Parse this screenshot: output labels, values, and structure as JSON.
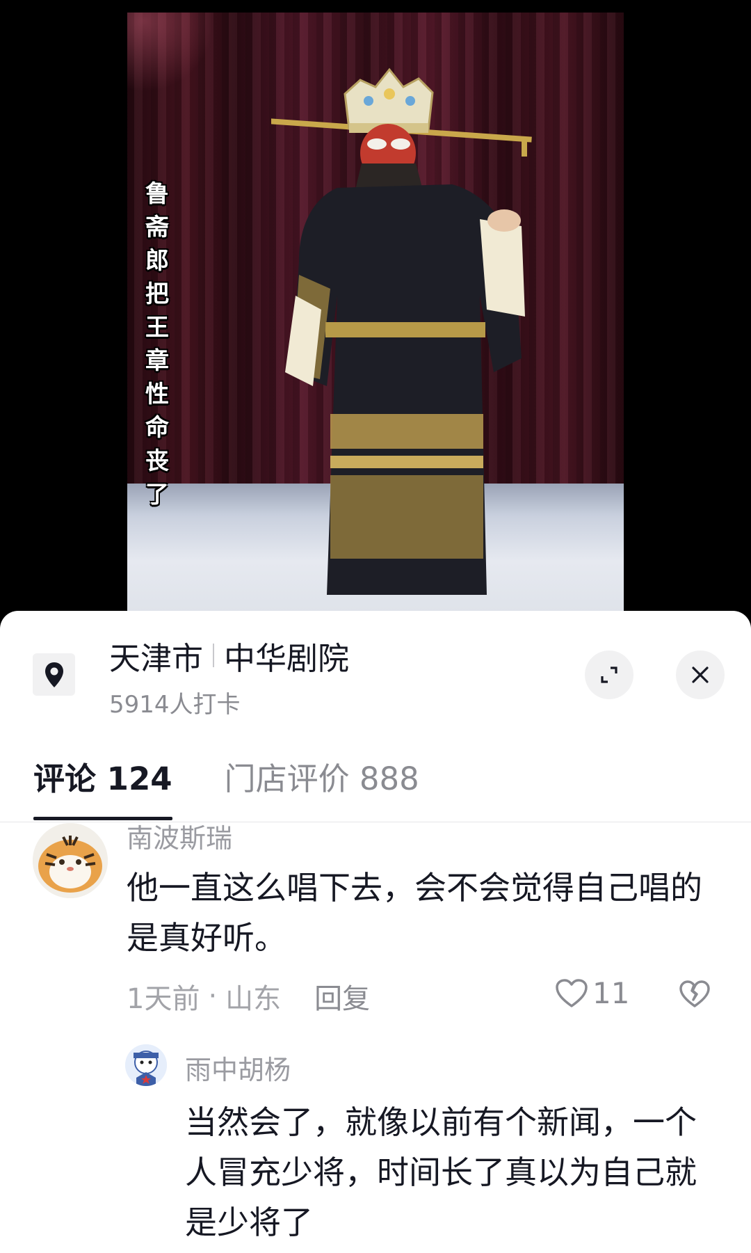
{
  "video": {
    "caption_chars": [
      "鲁",
      "斋",
      "郎",
      "把",
      "王",
      "章",
      "性",
      "命",
      "丧",
      "了"
    ]
  },
  "location": {
    "city": "天津市",
    "venue": "中华剧院",
    "checkins": "5914人打卡"
  },
  "tabs": [
    {
      "label": "评论 124",
      "active": true
    },
    {
      "label": "门店评价 888",
      "active": false
    }
  ],
  "comment": {
    "username": "南波斯瑞",
    "text": "他一直这么唱下去，会不会觉得自己唱的是真好听。",
    "time": "1天前",
    "separator": "·",
    "region": "山东",
    "reply_label": "回复",
    "likes": "11"
  },
  "reply": {
    "username": "雨中胡杨",
    "text": "当然会了，就像以前有个新闻，一个人冒充少将，时间长了真以为自己就是少将了"
  },
  "icons": {
    "location": "location-pin-icon",
    "expand": "expand-icon",
    "close": "close-icon",
    "like": "heart-icon",
    "dislike": "broken-heart-icon"
  },
  "colors": {
    "text_primary": "#161823",
    "text_secondary": "#8a8b91",
    "sheet_bg": "#ffffff",
    "button_bg": "#f1f1f2"
  }
}
